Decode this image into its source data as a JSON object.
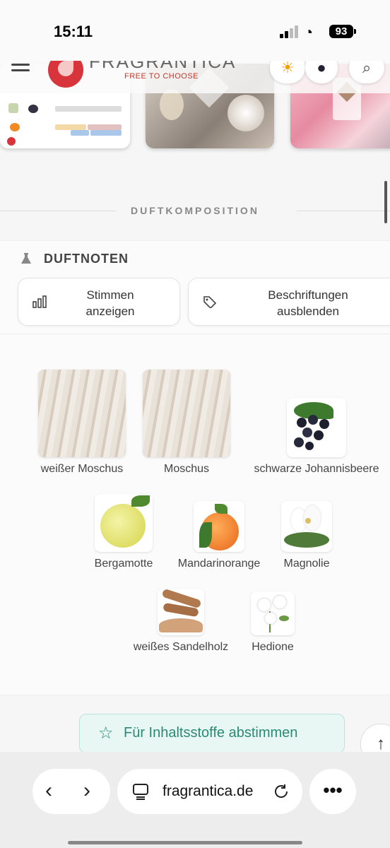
{
  "status": {
    "time": "15:11",
    "battery": "93"
  },
  "header": {
    "logo_text": "FRAGRANTICA",
    "logo_sub": "FREE TO CHOOSE"
  },
  "section": {
    "title": "DUFTKOMPOSITION"
  },
  "notes_panel": {
    "title": "DUFTNOTEN",
    "show_votes_label": "Stimmen\nanzeigen",
    "hide_labels_label": "Beschriftungen\nausblenden"
  },
  "notes": [
    {
      "name": "weißer Moschus",
      "icon": "fur-image"
    },
    {
      "name": "Moschus",
      "icon": "fur-image"
    },
    {
      "name": "schwarze Johannisbeere",
      "icon": "blackcurrant-image"
    },
    {
      "name": "Bergamotte",
      "icon": "bergamot-image"
    },
    {
      "name": "Mandarinorange",
      "icon": "mandarin-image"
    },
    {
      "name": "Magnolie",
      "icon": "magnolia-image"
    },
    {
      "name": "weißes Sandelholz",
      "icon": "sandalwood-image"
    },
    {
      "name": "Hedione",
      "icon": "jasmine-image"
    }
  ],
  "vote": {
    "label": "Für Inhaltsstoffe abstimmen"
  },
  "browser": {
    "url": "fragrantica.de"
  },
  "colors": {
    "accent": "#2a8a75",
    "brand": "#d8343c"
  }
}
